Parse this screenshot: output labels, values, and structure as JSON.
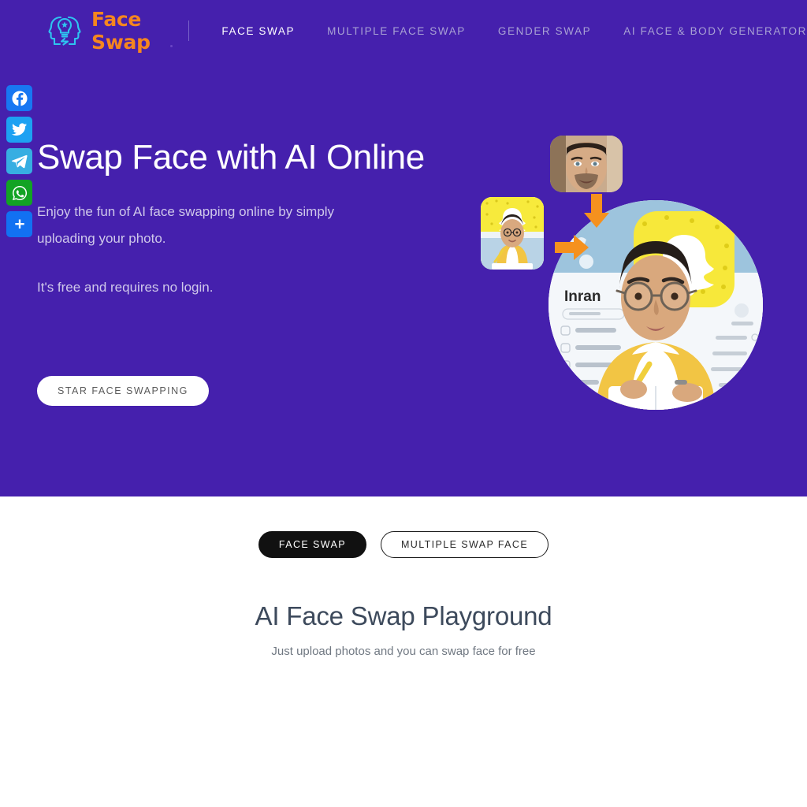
{
  "header": {
    "logo": {
      "icon": "face-swap-logo-icon",
      "text": "Face Swap"
    },
    "nav": [
      {
        "label": "FACE SWAP",
        "active": true
      },
      {
        "label": "MULTIPLE FACE SWAP",
        "active": false
      },
      {
        "label": "GENDER SWAP",
        "active": false
      },
      {
        "label": "AI FACE & BODY GENERATOR",
        "active": false
      }
    ]
  },
  "social_rail": [
    {
      "name": "facebook",
      "label": "Facebook",
      "color": "#1877f2"
    },
    {
      "name": "twitter",
      "label": "Twitter",
      "color": "#1da1f2"
    },
    {
      "name": "telegram",
      "label": "Telegram",
      "color": "#37aee2"
    },
    {
      "name": "whatsapp",
      "label": "WhatsApp",
      "color": "#12a324"
    },
    {
      "name": "share",
      "label": "Share",
      "color": "#1271f2"
    }
  ],
  "hero": {
    "title": "Swap Face with AI Online",
    "paragraph": "Enjoy the fun of AI face swapping online by simply uploading your photo.",
    "paragraph2": "It's free and requires no login.",
    "cta_label": "STAR FACE SWAPPING",
    "background_color": "#4520ad",
    "collage": {
      "source_face_alt": "source-face-photo",
      "target_thumb_alt": "target-photo-thumbnail",
      "result_alt": "swapped-result-photo",
      "result_username": "Inran",
      "arrow_color": "#f5911e"
    }
  },
  "playground": {
    "tabs": [
      {
        "label": "FACE SWAP",
        "active": true
      },
      {
        "label": "MULTIPLE SWAP FACE",
        "active": false
      }
    ],
    "title": "AI Face Swap Playground",
    "subtitle": "Just upload photos and you can swap face for free"
  }
}
